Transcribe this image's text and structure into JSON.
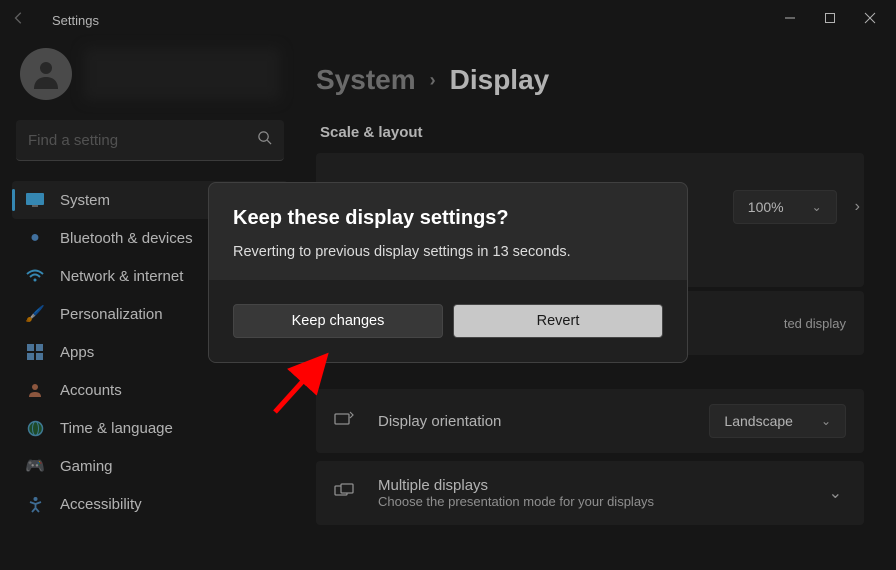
{
  "titlebar": {
    "title": "Settings"
  },
  "search": {
    "placeholder": "Find a setting"
  },
  "sidebar": {
    "items": [
      {
        "label": "System"
      },
      {
        "label": "Bluetooth & devices"
      },
      {
        "label": "Network & internet"
      },
      {
        "label": "Personalization"
      },
      {
        "label": "Apps"
      },
      {
        "label": "Accounts"
      },
      {
        "label": "Time & language"
      },
      {
        "label": "Gaming"
      },
      {
        "label": "Accessibility"
      }
    ]
  },
  "breadcrumb": {
    "parent": "System",
    "current": "Display"
  },
  "section": {
    "title": "Scale & layout"
  },
  "settings": {
    "scale_value": "100%",
    "resolution_desc_suffix": "ted display",
    "orientation": {
      "label": "Display orientation",
      "value": "Landscape"
    },
    "multiple": {
      "label": "Multiple displays",
      "desc": "Choose the presentation mode for your displays"
    }
  },
  "dialog": {
    "title": "Keep these display settings?",
    "message": "Reverting to previous display settings in 13 seconds.",
    "keep": "Keep changes",
    "revert": "Revert"
  }
}
